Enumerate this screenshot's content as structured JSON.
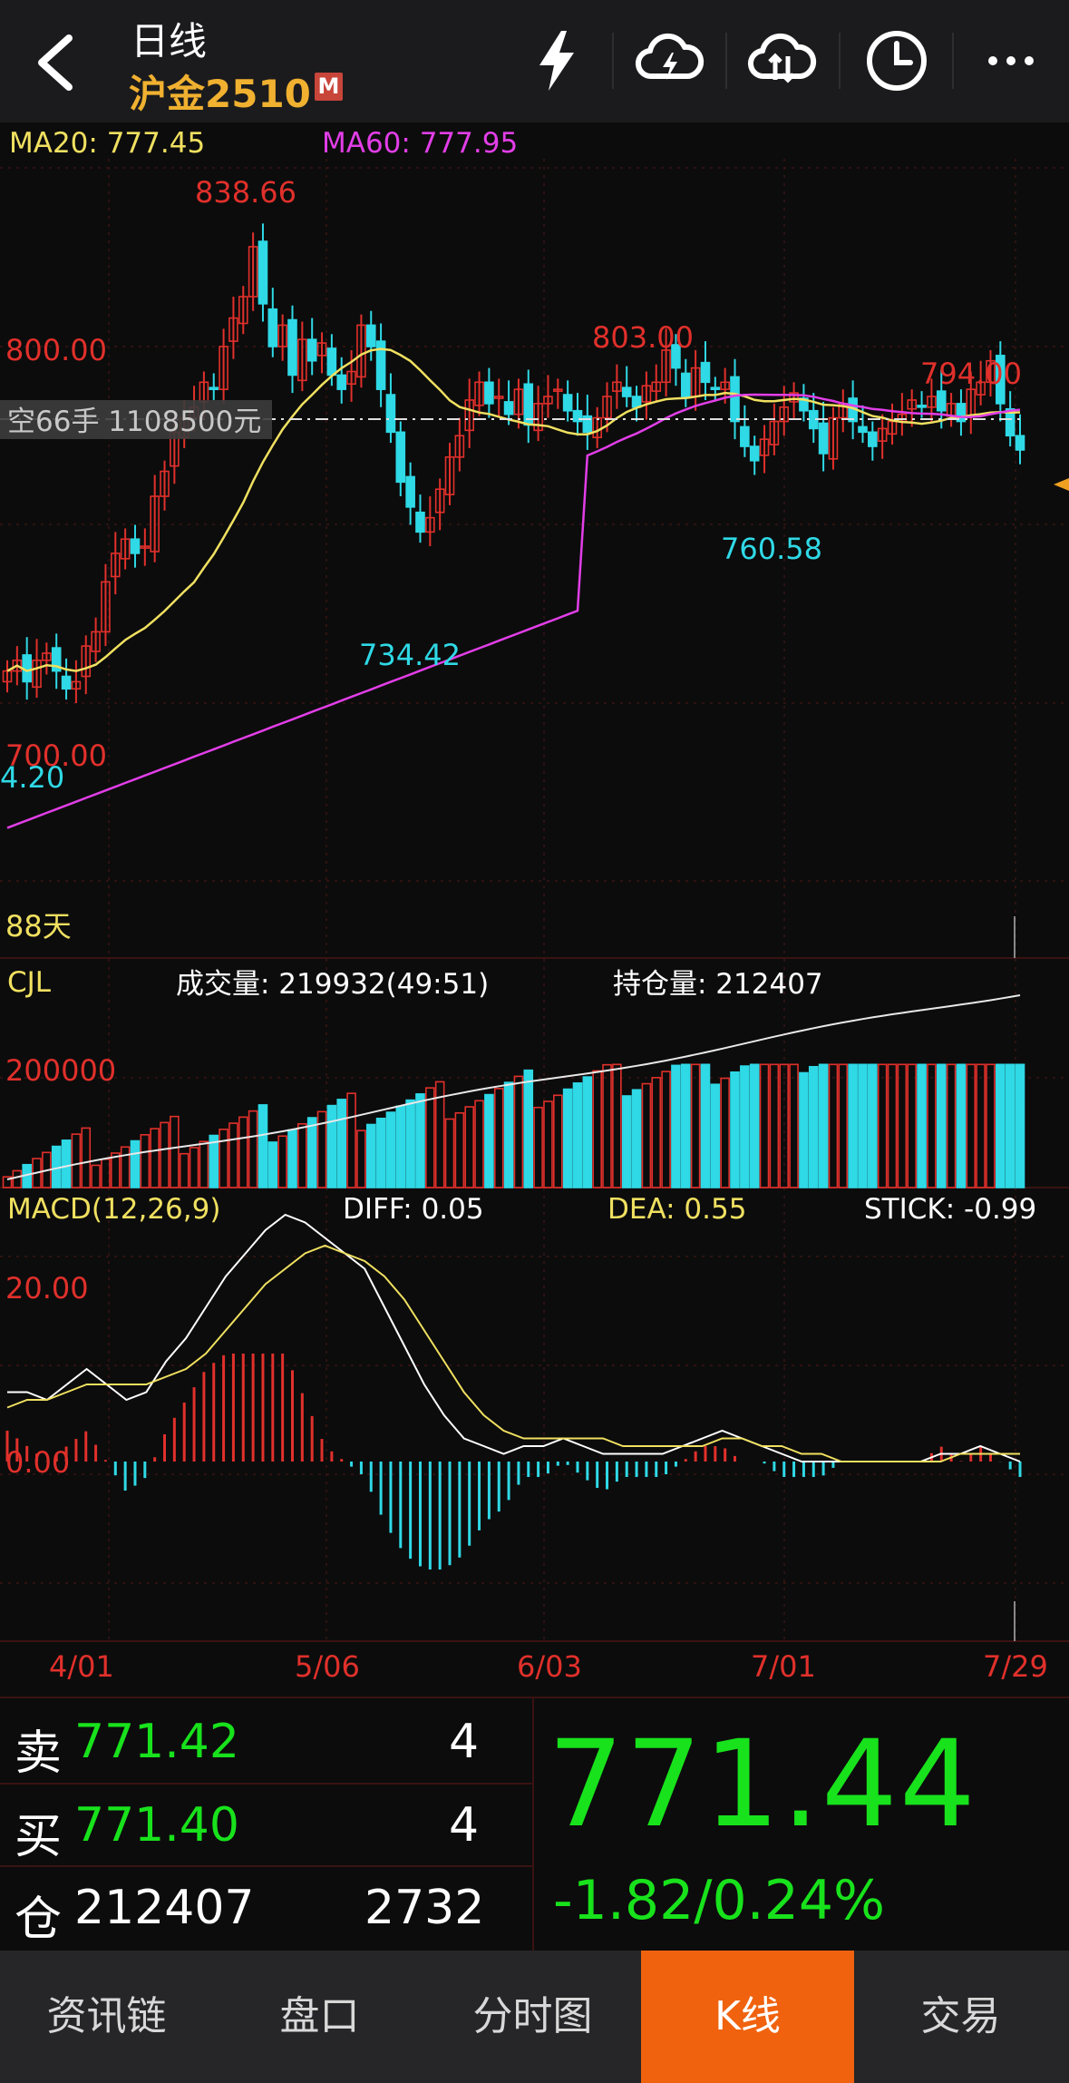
{
  "header": {
    "period": "日线",
    "contract": "沪金2510",
    "badge": "M",
    "icons": [
      "flash-icon",
      "cloud-flash-icon",
      "cloud-sync-icon",
      "clock-icon",
      "more-icon"
    ]
  },
  "kline": {
    "ma20_label": "MA20: 777.45",
    "ma60_label": "MA60: 777.95",
    "price_labels": [
      "838.66",
      "803.00",
      "794.00",
      "800.00",
      "760.58",
      "734.42",
      "700.00",
      "4.20",
      "88天"
    ],
    "short_position": "空66手 1108500元",
    "last_close": 771.44
  },
  "volume": {
    "title": "CJL",
    "volume_label": "成交量: 219932(49:51)",
    "oi_label": "持仓量: 212407",
    "axis_label": "200000"
  },
  "macd": {
    "title": "MACD(12,26,9)",
    "diff": "DIFF: 0.05",
    "dea": "DEA: 0.55",
    "stick": "STICK: -0.99",
    "axis_top": "20.00",
    "axis_zero": "0.00"
  },
  "dates": [
    "4/01",
    "5/06",
    "6/03",
    "7/01",
    "7/29"
  ],
  "quote": {
    "sell_label": "卖",
    "sell_price": "771.42",
    "sell_qty": "4",
    "buy_label": "买",
    "buy_price": "771.40",
    "buy_qty": "4",
    "oi_label": "仓",
    "oi_value": "212407",
    "oi_change": "2732",
    "last_price": "771.44",
    "change": "-1.82/0.24%"
  },
  "tabs": [
    "资讯链",
    "盘口",
    "分时图",
    "K线",
    "交易"
  ],
  "colors": {
    "up": "#e1302b",
    "down": "#2fd9e6",
    "ma20": "#f0e060",
    "ma60": "#e23ee8",
    "green": "#18e21c",
    "orange": "#f0620e"
  },
  "chart_data": {
    "type": "line",
    "candles_close": [
      709,
      712,
      706,
      712,
      714,
      709,
      704,
      706,
      716,
      720,
      734,
      742,
      746,
      742,
      744,
      758,
      765,
      776,
      780,
      783,
      790,
      788,
      800,
      808,
      814,
      828,
      812,
      800,
      806,
      792,
      802,
      796,
      801,
      792,
      788,
      793,
      806,
      800,
      788,
      776,
      762,
      755,
      748,
      752,
      760,
      769,
      775,
      785,
      790,
      784,
      786,
      781,
      788,
      778,
      784,
      786,
      788,
      782,
      779,
      776,
      780,
      786,
      790,
      786,
      783,
      789,
      790,
      799,
      794,
      786,
      794,
      790,
      788,
      790,
      779,
      772,
      768,
      774,
      779,
      783,
      787,
      782,
      777,
      770,
      780,
      784,
      779,
      776,
      772,
      777,
      779,
      781,
      785,
      783,
      786,
      782,
      784,
      779,
      788,
      790,
      796,
      784,
      775,
      771
    ],
    "macd_dif": [
      9,
      9,
      8,
      10,
      12,
      10,
      8,
      9,
      13,
      16,
      20,
      24,
      27,
      30,
      32,
      31,
      29,
      27,
      25,
      20,
      15,
      10,
      6,
      3,
      2,
      1,
      2,
      2,
      3,
      2,
      1,
      1,
      1,
      1,
      2,
      3,
      4,
      3,
      2,
      1,
      0,
      0,
      0,
      0,
      0,
      0,
      0,
      1,
      1,
      2,
      1,
      0
    ],
    "macd_dea": [
      7,
      8,
      8,
      9,
      10,
      10,
      10,
      10,
      11,
      12,
      14,
      17,
      20,
      23,
      25,
      27,
      28,
      27,
      26,
      24,
      21,
      17,
      13,
      9,
      6,
      4,
      3,
      3,
      3,
      3,
      3,
      2,
      2,
      2,
      2,
      2,
      3,
      3,
      2,
      2,
      1,
      1,
      0,
      0,
      0,
      0,
      0,
      0,
      1,
      1,
      1,
      1
    ]
  }
}
